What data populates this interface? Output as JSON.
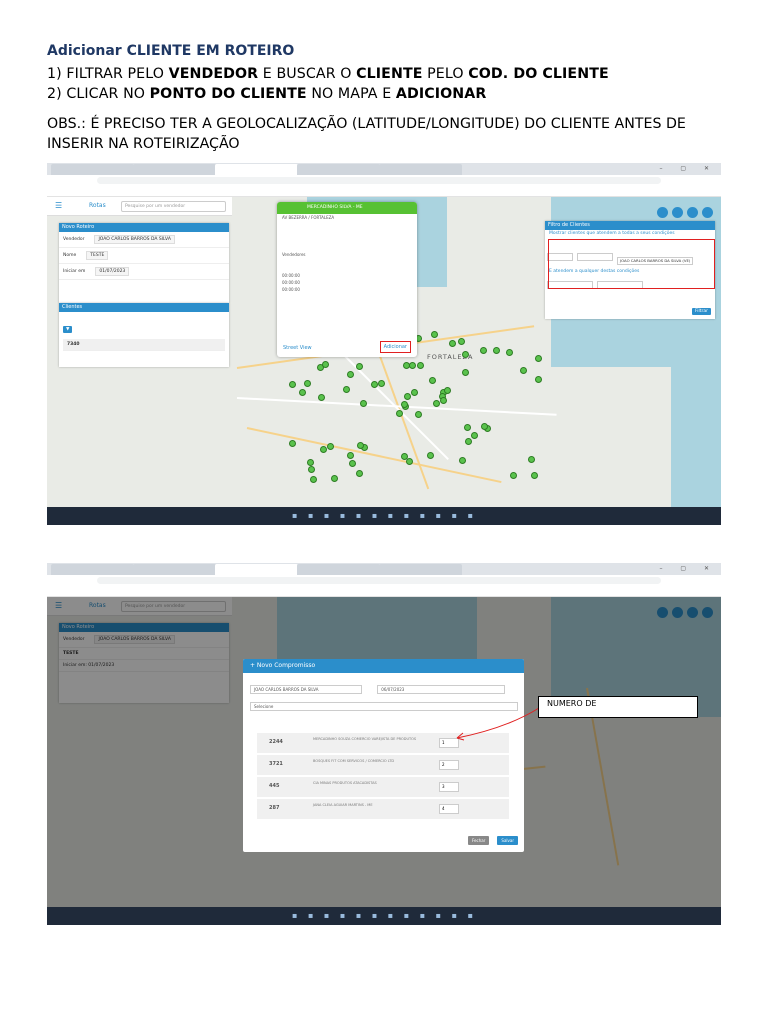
{
  "heading": "Adicionar CLIENTE EM ROTEIRO",
  "step1": {
    "n": "1)",
    "a": "FILTRAR PELO ",
    "b": "VENDEDOR",
    "c": " E BUSCAR O ",
    "d": "CLIENTE",
    "e": " PELO ",
    "f": "COD. DO CLIENTE"
  },
  "step2": {
    "n": "2)",
    "a": "CLICAR NO ",
    "b": "PONTO DO CLIENTE",
    "c": " NO MAPA E ",
    "d": "ADICIONAR"
  },
  "obs": "OBS.: É PRECISO TER A GEOLOCALIZAÇÃO (LATITUDE/LONGITUDE) DO CLIENTE ANTES DE INSERIR NA ROTEIRIZAÇÃO",
  "shot1": {
    "app_title": "Rotas",
    "search_placeholder": "Pesquise por um vendedor",
    "panel_title": "Novo Roteiro",
    "vendedor_label": "Vendedor",
    "vendedor_value": "JOAO CARLOS BARROS DA SILVA",
    "nome_label": "Nome",
    "nome_value": "TESTE",
    "inicio_label": "Iniciar em",
    "inicio_value": "01/07/2023",
    "clientes_title": "Clientes",
    "client_code": "7340",
    "popup_bar": "MERCADINHO SILVA - ME",
    "popup_lines": [
      "AV BEZERRA / FORTALEZA",
      "Vendedores",
      "00:00:00",
      "00:00:00",
      "00:00:00"
    ],
    "street_view": "Street View",
    "adicionar": "Adicionar",
    "city": "FORTALEZA",
    "filter_title": "Filtro de Clientes",
    "filter_line1": "Mostrar clientes que atendem a todas a seus condições",
    "filter_value": "JOAO CARLOS BARROS DA SILVA (VE)",
    "filter_line2": "E atendem a qualquer destas condições",
    "filter_btn": "Filtrar"
  },
  "shot2": {
    "panel_title": "Novo Roteiro",
    "roteiro_name": "TESTE",
    "roteiro_date": "Iniciar em: 01/07/2023",
    "modal_title": "+ Novo Compromisso",
    "modal_vendedor": "JOAO CARLOS BARROS DA SILVA",
    "modal_date": "06/07/2023",
    "modal_select": "Selecione",
    "items": [
      {
        "code": "2244",
        "desc": "MERCADINHO SOUZA COMERCIO VAREJISTA DE PRODUTOS"
      },
      {
        "code": "3721",
        "desc": "BOSQUES FIT COM SERVICOS / COMERCIO LTD"
      },
      {
        "code": "445",
        "desc": "CIA MINAS PRODUTOS ATACADISTAS"
      },
      {
        "code": "287",
        "desc": "JANA CLEIA AGUIAR MARTINS - ME"
      }
    ],
    "btn_close": "Fechar",
    "btn_save": "Salvar",
    "note": "NUMERO DE"
  },
  "colors": {
    "heading": "#1f3864",
    "primary": "#2b8ecb",
    "pin": "#5ac24d",
    "highlight": "#e02020"
  }
}
